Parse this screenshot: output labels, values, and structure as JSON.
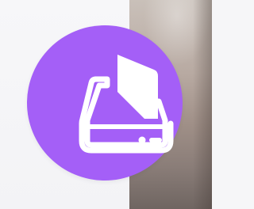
{
  "app_icon": {
    "icon_name": "scanner-icon",
    "background_color": "#a45ff7",
    "glyph_color": "#ffffff"
  }
}
